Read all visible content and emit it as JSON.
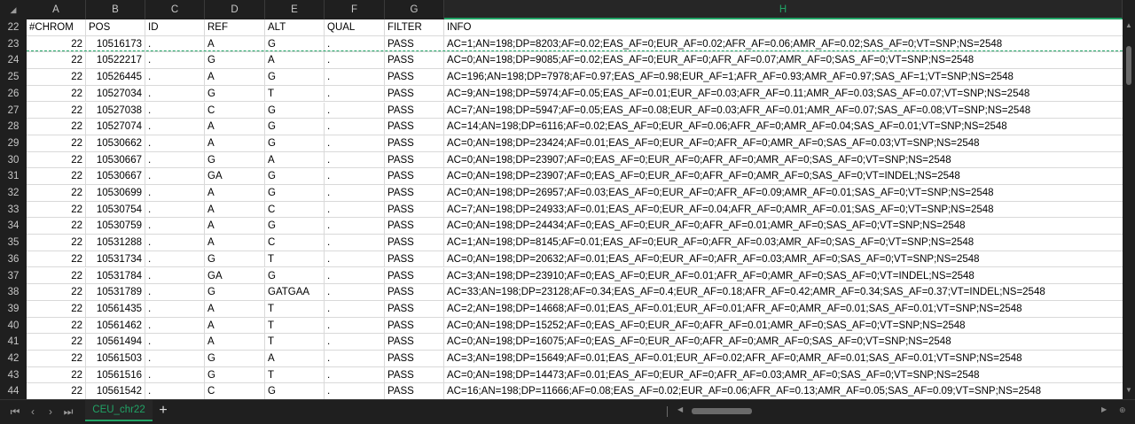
{
  "columns": [
    "A",
    "B",
    "C",
    "D",
    "E",
    "F",
    "G",
    "H"
  ],
  "selected_column": "H",
  "header_row": {
    "num": "22",
    "cells": [
      "#CHROM",
      "POS",
      "ID",
      "REF",
      "ALT",
      "QUAL",
      "FILTER",
      "INFO"
    ]
  },
  "rows": [
    {
      "num": "23",
      "cells": [
        "22",
        "10516173",
        ".",
        "A",
        "G",
        ".",
        "PASS",
        "AC=1;AN=198;DP=8203;AF=0.02;EAS_AF=0;EUR_AF=0.02;AFR_AF=0.06;AMR_AF=0.02;SAS_AF=0;VT=SNP;NS=2548"
      ]
    },
    {
      "num": "24",
      "cells": [
        "22",
        "10522217",
        ".",
        "G",
        "A",
        ".",
        "PASS",
        "AC=0;AN=198;DP=9085;AF=0.02;EAS_AF=0;EUR_AF=0;AFR_AF=0.07;AMR_AF=0;SAS_AF=0;VT=SNP;NS=2548"
      ]
    },
    {
      "num": "25",
      "cells": [
        "22",
        "10526445",
        ".",
        "A",
        "G",
        ".",
        "PASS",
        "AC=196;AN=198;DP=7978;AF=0.97;EAS_AF=0.98;EUR_AF=1;AFR_AF=0.93;AMR_AF=0.97;SAS_AF=1;VT=SNP;NS=2548"
      ]
    },
    {
      "num": "26",
      "cells": [
        "22",
        "10527034",
        ".",
        "G",
        "T",
        ".",
        "PASS",
        "AC=9;AN=198;DP=5974;AF=0.05;EAS_AF=0.01;EUR_AF=0.03;AFR_AF=0.11;AMR_AF=0.03;SAS_AF=0.07;VT=SNP;NS=2548"
      ]
    },
    {
      "num": "27",
      "cells": [
        "22",
        "10527038",
        ".",
        "C",
        "G",
        ".",
        "PASS",
        "AC=7;AN=198;DP=5947;AF=0.05;EAS_AF=0.08;EUR_AF=0.03;AFR_AF=0.01;AMR_AF=0.07;SAS_AF=0.08;VT=SNP;NS=2548"
      ]
    },
    {
      "num": "28",
      "cells": [
        "22",
        "10527074",
        ".",
        "A",
        "G",
        ".",
        "PASS",
        "AC=14;AN=198;DP=6116;AF=0.02;EAS_AF=0;EUR_AF=0.06;AFR_AF=0;AMR_AF=0.04;SAS_AF=0.01;VT=SNP;NS=2548"
      ]
    },
    {
      "num": "29",
      "cells": [
        "22",
        "10530662",
        ".",
        "A",
        "G",
        ".",
        "PASS",
        "AC=0;AN=198;DP=23424;AF=0.01;EAS_AF=0;EUR_AF=0;AFR_AF=0;AMR_AF=0;SAS_AF=0.03;VT=SNP;NS=2548"
      ]
    },
    {
      "num": "30",
      "cells": [
        "22",
        "10530667",
        ".",
        "G",
        "A",
        ".",
        "PASS",
        "AC=0;AN=198;DP=23907;AF=0;EAS_AF=0;EUR_AF=0;AFR_AF=0;AMR_AF=0;SAS_AF=0;VT=SNP;NS=2548"
      ]
    },
    {
      "num": "31",
      "cells": [
        "22",
        "10530667",
        ".",
        "GA",
        "G",
        ".",
        "PASS",
        "AC=0;AN=198;DP=23907;AF=0;EAS_AF=0;EUR_AF=0;AFR_AF=0;AMR_AF=0;SAS_AF=0;VT=INDEL;NS=2548"
      ]
    },
    {
      "num": "32",
      "cells": [
        "22",
        "10530699",
        ".",
        "A",
        "G",
        ".",
        "PASS",
        "AC=0;AN=198;DP=26957;AF=0.03;EAS_AF=0;EUR_AF=0;AFR_AF=0.09;AMR_AF=0.01;SAS_AF=0;VT=SNP;NS=2548"
      ]
    },
    {
      "num": "33",
      "cells": [
        "22",
        "10530754",
        ".",
        "A",
        "C",
        ".",
        "PASS",
        "AC=7;AN=198;DP=24933;AF=0.01;EAS_AF=0;EUR_AF=0.04;AFR_AF=0;AMR_AF=0.01;SAS_AF=0;VT=SNP;NS=2548"
      ]
    },
    {
      "num": "34",
      "cells": [
        "22",
        "10530759",
        ".",
        "A",
        "G",
        ".",
        "PASS",
        "AC=0;AN=198;DP=24434;AF=0;EAS_AF=0;EUR_AF=0;AFR_AF=0.01;AMR_AF=0;SAS_AF=0;VT=SNP;NS=2548"
      ]
    },
    {
      "num": "35",
      "cells": [
        "22",
        "10531288",
        ".",
        "A",
        "C",
        ".",
        "PASS",
        "AC=1;AN=198;DP=8145;AF=0.01;EAS_AF=0;EUR_AF=0;AFR_AF=0.03;AMR_AF=0;SAS_AF=0;VT=SNP;NS=2548"
      ]
    },
    {
      "num": "36",
      "cells": [
        "22",
        "10531734",
        ".",
        "G",
        "T",
        ".",
        "PASS",
        "AC=0;AN=198;DP=20632;AF=0.01;EAS_AF=0;EUR_AF=0;AFR_AF=0.03;AMR_AF=0;SAS_AF=0;VT=SNP;NS=2548"
      ]
    },
    {
      "num": "37",
      "cells": [
        "22",
        "10531784",
        ".",
        "GA",
        "G",
        ".",
        "PASS",
        "AC=3;AN=198;DP=23910;AF=0;EAS_AF=0;EUR_AF=0.01;AFR_AF=0;AMR_AF=0;SAS_AF=0;VT=INDEL;NS=2548"
      ]
    },
    {
      "num": "38",
      "cells": [
        "22",
        "10531789",
        ".",
        "G",
        "GATGAA",
        ".",
        "PASS",
        "AC=33;AN=198;DP=23128;AF=0.34;EAS_AF=0.4;EUR_AF=0.18;AFR_AF=0.42;AMR_AF=0.34;SAS_AF=0.37;VT=INDEL;NS=2548"
      ]
    },
    {
      "num": "39",
      "cells": [
        "22",
        "10561435",
        ".",
        "A",
        "T",
        ".",
        "PASS",
        "AC=2;AN=198;DP=14668;AF=0.01;EAS_AF=0.01;EUR_AF=0.01;AFR_AF=0;AMR_AF=0.01;SAS_AF=0.01;VT=SNP;NS=2548"
      ]
    },
    {
      "num": "40",
      "cells": [
        "22",
        "10561462",
        ".",
        "A",
        "T",
        ".",
        "PASS",
        "AC=0;AN=198;DP=15252;AF=0;EAS_AF=0;EUR_AF=0;AFR_AF=0.01;AMR_AF=0;SAS_AF=0;VT=SNP;NS=2548"
      ]
    },
    {
      "num": "41",
      "cells": [
        "22",
        "10561494",
        ".",
        "A",
        "T",
        ".",
        "PASS",
        "AC=0;AN=198;DP=16075;AF=0;EAS_AF=0;EUR_AF=0;AFR_AF=0;AMR_AF=0;SAS_AF=0;VT=SNP;NS=2548"
      ]
    },
    {
      "num": "42",
      "cells": [
        "22",
        "10561503",
        ".",
        "G",
        "A",
        ".",
        "PASS",
        "AC=3;AN=198;DP=15649;AF=0.01;EAS_AF=0.01;EUR_AF=0.02;AFR_AF=0;AMR_AF=0.01;SAS_AF=0.01;VT=SNP;NS=2548"
      ]
    },
    {
      "num": "43",
      "cells": [
        "22",
        "10561516",
        ".",
        "G",
        "T",
        ".",
        "PASS",
        "AC=0;AN=198;DP=14473;AF=0.01;EAS_AF=0;EUR_AF=0;AFR_AF=0.03;AMR_AF=0;SAS_AF=0;VT=SNP;NS=2548"
      ]
    },
    {
      "num": "44",
      "cells": [
        "22",
        "10561542",
        ".",
        "C",
        "G",
        ".",
        "PASS",
        "AC=16;AN=198;DP=11666;AF=0.08;EAS_AF=0.02;EUR_AF=0.06;AFR_AF=0.13;AMR_AF=0.05;SAS_AF=0.09;VT=SNP;NS=2548"
      ]
    }
  ],
  "sheet_tab": {
    "label": "CEU_chr22"
  },
  "add_sheet_label": "+",
  "icons": {
    "select_all": "select-all-triangle-icon",
    "nav_first": "first-sheet-icon",
    "nav_prev": "prev-sheet-icon",
    "nav_next": "next-sheet-icon",
    "nav_last": "last-sheet-icon"
  },
  "colors": {
    "accent": "#21a366",
    "chrome": "#1f1f1f",
    "grid": "#ffffff"
  }
}
